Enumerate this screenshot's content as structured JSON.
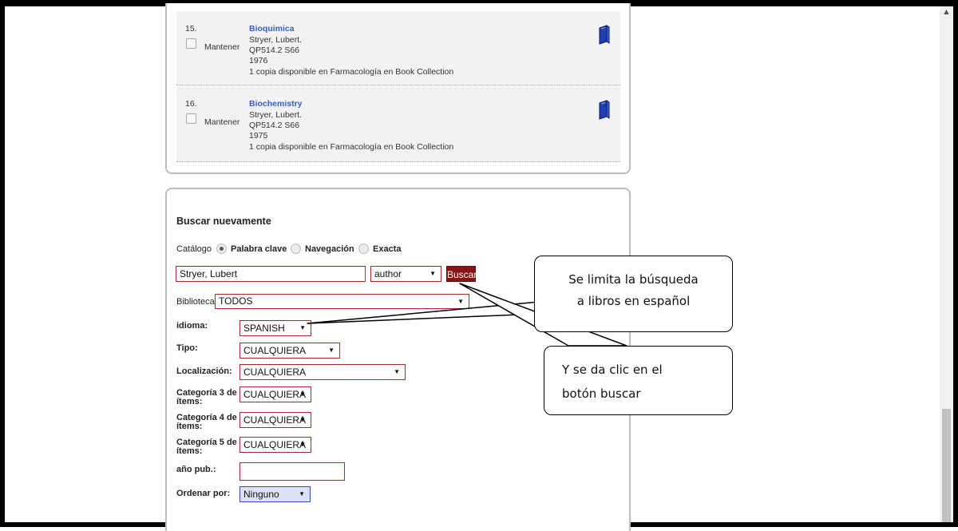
{
  "results": [
    {
      "number": "15.",
      "keep_label": "Mantener",
      "title": "Bioquimica",
      "author": "Stryer, Lubert.",
      "call_number": "QP514.2 S66",
      "year": "1976",
      "availability": "1 copia disponible en Farmacología en Book Collection",
      "icon": "book-icon"
    },
    {
      "number": "16.",
      "keep_label": "Mantener",
      "title": "Biochemistry",
      "author": "Stryer, Lubert.",
      "call_number": "QP514.2 S66",
      "year": "1975",
      "availability": "1 copia disponible en Farmacología en Book Collection",
      "icon": "book-icon"
    }
  ],
  "search": {
    "heading": "Buscar nuevamente",
    "catalog_label": "Catálogo",
    "modes": [
      "Palabra clave",
      "Navegación",
      "Exacta"
    ],
    "selected_mode": "Palabra clave",
    "query_value": "Stryer, Lubert",
    "index_value": "author",
    "button_label": "Buscar",
    "library_label": "Biblioteca:",
    "library_value": "TODOS",
    "filters": [
      {
        "label": "idioma:",
        "value": "SPANISH"
      },
      {
        "label": "Tipo:",
        "value": "CUALQUIERA"
      },
      {
        "label": "Localización:",
        "value": "CUALQUIERA"
      },
      {
        "label": "Categoría 3 de ítems:",
        "value": "CUALQUIERA"
      },
      {
        "label": "Categoría 4 de ítems:",
        "value": "CUALQUIERA"
      },
      {
        "label": "Categoría 5 de ítems:",
        "value": "CUALQUIERA"
      },
      {
        "label": "año pub.:",
        "value": ""
      }
    ],
    "sort_label": "Ordenar por:",
    "sort_value": "Ninguno"
  },
  "callouts": {
    "language_line1": "Se limita la búsqueda",
    "language_line2": "a libros en español",
    "button_line1": "Y se da clic en el",
    "button_line2": "botón buscar"
  },
  "colors": {
    "link": "#3b5fc0",
    "accent": "#8b1212",
    "field_border": "#a52a2a"
  }
}
